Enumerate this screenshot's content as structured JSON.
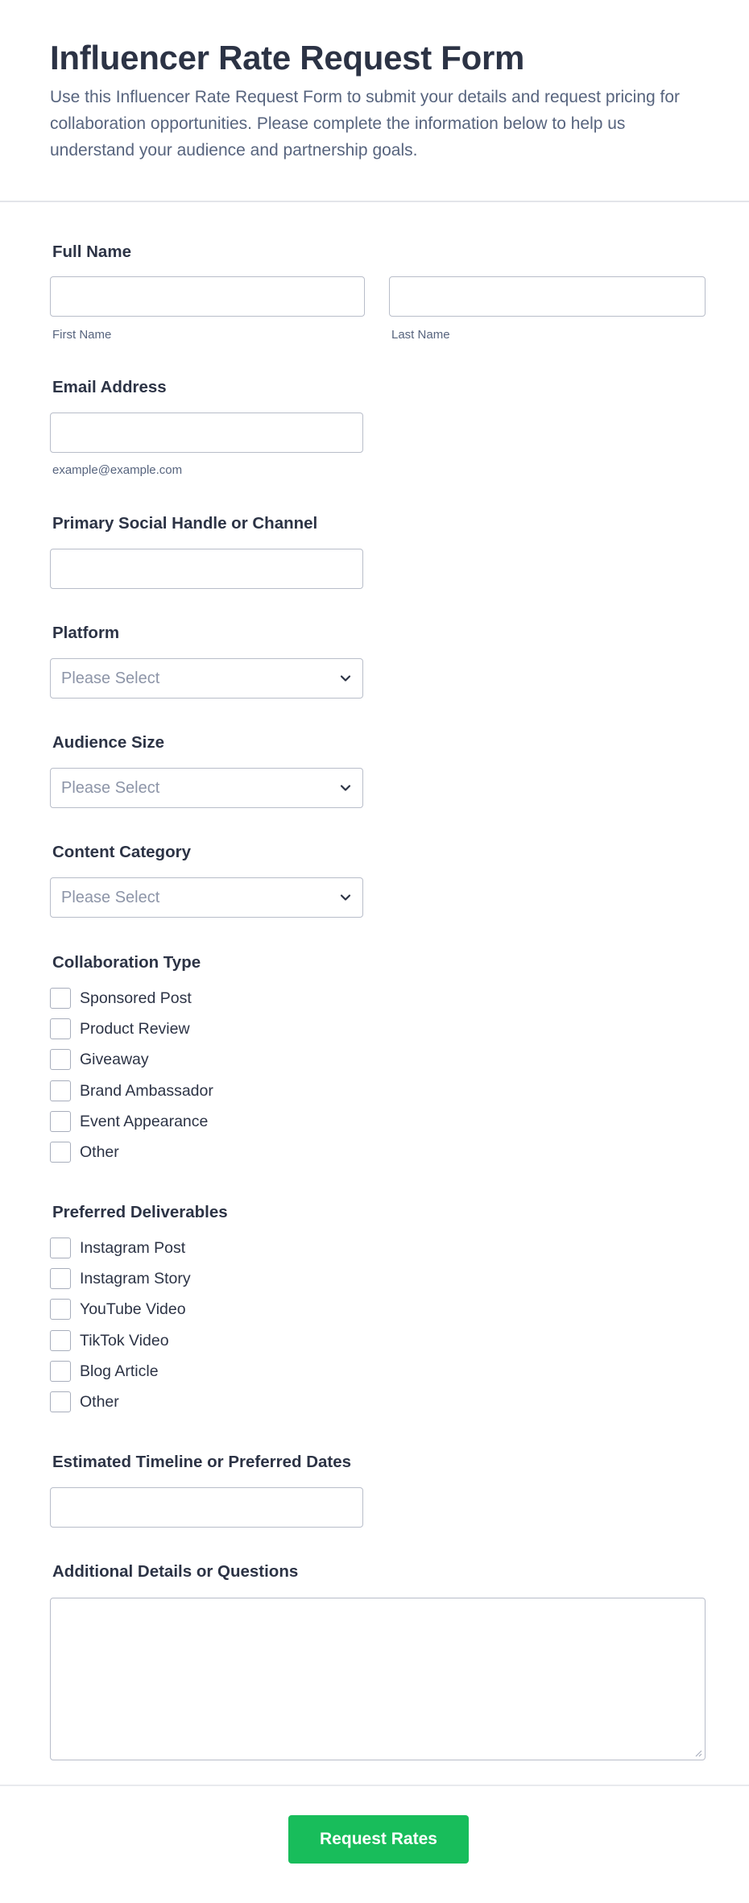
{
  "header": {
    "title": "Influencer Rate Request Form",
    "description": "Use this Influencer Rate Request Form to submit your details and request pricing for collaboration opportunities. Please complete the information below to help us understand your audience and partnership goals."
  },
  "full_name": {
    "label": "Full Name",
    "first_sublabel": "First Name",
    "last_sublabel": "Last Name",
    "first_value": "",
    "last_value": ""
  },
  "email": {
    "label": "Email Address",
    "sublabel": "example@example.com",
    "value": ""
  },
  "social_handle": {
    "label": "Primary Social Handle or Channel",
    "value": ""
  },
  "platform": {
    "label": "Platform",
    "selected": "Please Select"
  },
  "audience_size": {
    "label": "Audience Size",
    "selected": "Please Select"
  },
  "content_category": {
    "label": "Content Category",
    "selected": "Please Select"
  },
  "collaboration_type": {
    "label": "Collaboration Type",
    "options": [
      "Sponsored Post",
      "Product Review",
      "Giveaway",
      "Brand Ambassador",
      "Event Appearance",
      "Other"
    ]
  },
  "deliverables": {
    "label": "Preferred Deliverables",
    "options": [
      "Instagram Post",
      "Instagram Story",
      "YouTube Video",
      "TikTok Video",
      "Blog Article",
      "Other"
    ]
  },
  "timeline": {
    "label": "Estimated Timeline or Preferred Dates",
    "value": ""
  },
  "details": {
    "label": "Additional Details or Questions",
    "value": ""
  },
  "submit": {
    "label": "Request Rates"
  },
  "colors": {
    "title": "#2c3345",
    "description": "#57647e",
    "border": "#b8bdc9",
    "submit": "#18bd5b",
    "placeholder": "#8d95a8"
  },
  "icons": {
    "select_caret": "chevron-down-icon",
    "textarea_grip": "resize-grip-icon"
  }
}
